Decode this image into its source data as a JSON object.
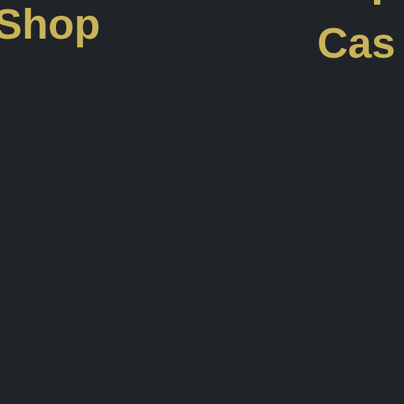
{
  "menu": {
    "shop_label": "Shop",
    "cas_label": "Cas"
  },
  "colors": {
    "background": "#202428",
    "text_accent": "#c9b35a"
  }
}
